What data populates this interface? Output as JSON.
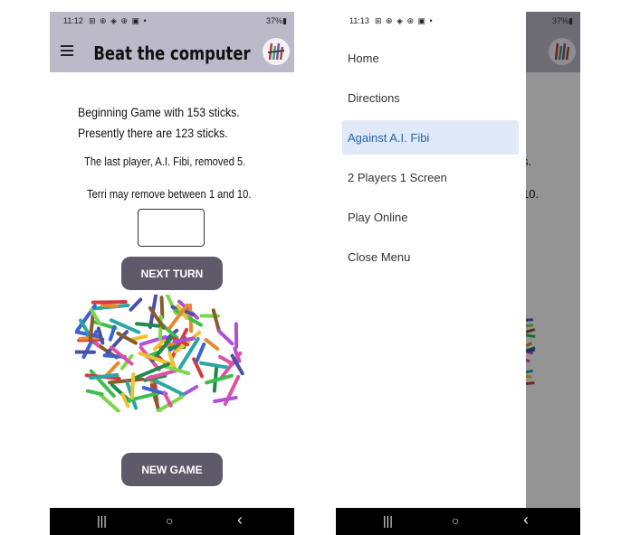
{
  "left": {
    "status": {
      "time": "11:12",
      "icons": "⊞ ⊕ ◈ ⊕ ▣ •",
      "battery": "37%▮"
    },
    "appbar": {
      "title": "Beat the computer"
    },
    "game": {
      "beginning": "Beginning Game with 153 sticks.",
      "presently": "Presently there are 123 sticks.",
      "last_player": "The last player, A.I. Fibi, removed 5.",
      "may_remove": "Terri  may remove between 1 and 10.",
      "input_value": ""
    },
    "buttons": {
      "next_turn": "NEXT TURN",
      "new_game": "NEW GAME"
    },
    "stick_colors": [
      "#d33c3c",
      "#3cbf4a",
      "#3c63d6",
      "#b04fd8",
      "#e68a2e",
      "#2aa6a6",
      "#8a5a2b",
      "#e04fa4",
      "#7bd64c",
      "#4a4fa8",
      "#f0c030",
      "#1f8a4c"
    ]
  },
  "right": {
    "status": {
      "time": "11:13",
      "icons": "⊞ ⊕ ◈ ⊕ ▣ •",
      "battery": "37%▮"
    },
    "menu": {
      "items": [
        "Home",
        "Directions",
        "Against A.I. Fibi",
        "2 Players 1 Screen",
        "Play Online",
        "Close Menu"
      ]
    },
    "peek": {
      "line1": "s.",
      "line2": "10."
    }
  },
  "navbar": {
    "recent": "|||",
    "home": "○",
    "back": "‹"
  },
  "colors": {
    "appbar": "#bcb9c8",
    "button": "#5f5a6a",
    "menu_active_bg": "#dfe9f7",
    "menu_active_text": "#2563b0"
  }
}
